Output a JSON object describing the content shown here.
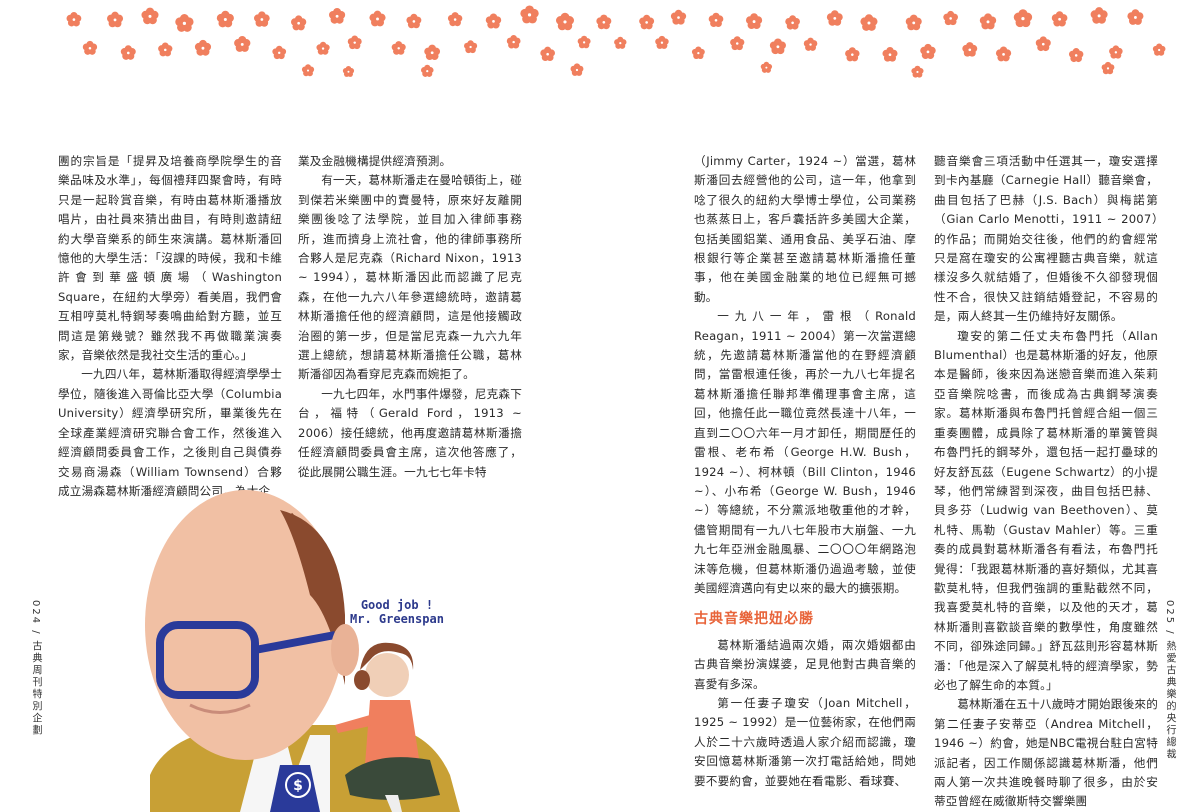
{
  "decoration": {
    "flower_color": "#f07f5e",
    "flower_center": "#ffffff"
  },
  "page_left": {
    "marker": "024 / 古典周刊特別企劃"
  },
  "page_right": {
    "marker": "025 / 熱愛古典樂的央行總裁"
  },
  "illustration": {
    "speech_line1": "Good job !",
    "speech_line2": "Mr. Greenspan",
    "tie_symbol": "$"
  },
  "col1": {
    "p1": "團的宗旨是「提昇及培養商學院學生的音樂品味及水準」，每個禮拜四聚會時，有時只是一起聆賞音樂，有時由葛林斯潘播放唱片，由社員來猜出曲目，有時則邀請紐約大學音樂系的師生來演講。葛林斯潘回憶他的大學生活：「沒課的時候，我和卡維許會到華盛頓廣場（Washington Square，在紐約大學旁）看美眉，我們會互相哼莫札特鋼琴奏鳴曲給對方聽，並互問這是第幾號？雖然我不再做職業演奏家，音樂依然是我社交生活的重心。」",
    "p2": "一九四八年，葛林斯潘取得經濟學學士學位，隨後進入哥倫比亞大學（Columbia University）經濟學研究所，畢業後先在全球產業經濟研究聯合會工作，然後進入經濟顧問委員會工作，之後則自己與債券交易商湯森（William Townsend）合夥成立湯森葛林斯潘經濟顧問公司，為大企"
  },
  "col2": {
    "p1": "業及金融機構提供經濟預測。",
    "p2": "有一天，葛林斯潘走在曼哈頓街上，碰到傑若米樂團中的賣曼特，原來好友離開樂團後唸了法學院，並目加入律師事務所，進而擠身上流社會，他的律師事務所合夥人是尼克森（Richard Nixon，1913 ~ 1994），葛林斯潘因此而認識了尼克森，在他一九六八年參選總統時，邀請葛林斯潘擔任他的經濟顧問，這是他接觸政治圈的第一步，但是當尼克森一九六九年選上總統，想請葛林斯潘擔任公職，葛林斯潘卻因為看穿尼克森而婉拒了。",
    "p3": "一九七四年，水門事件爆發，尼克森下台，福特（Gerald Ford，1913 ~ 2006）接任總統，他再度邀請葛林斯潘擔任經濟顧問委員會主席，這次他答應了，從此展開公職生涯。一九七七年卡特"
  },
  "col3": {
    "p1": "（Jimmy Carter，1924 ~）當選，葛林斯潘回去經營他的公司，這一年，他拿到唸了很久的紐約大學博士學位，公司業務也蒸蒸日上，客戶囊括許多美國大企業，包括美國鋁業、通用食品、美孚石油、摩根銀行等企業甚至邀請葛林斯潘擔任董事，他在美國金融業的地位已經無可撼動。",
    "p2": "一九八一年，雷根（Ronald Reagan，1911 ~ 2004）第一次當選總統，先邀請葛林斯潘當他的在野經濟顧問，當雷根連任後，再於一九八七年提名葛林斯潘擔任聯邦準備理事會主席，這回，他擔任此一職位竟然長達十八年，一直到二〇〇六年一月才卸任，期間歷任的雷根、老布希（George H.W. Bush，1924 ~）、柯林頓（Bill Clinton，1946 ~）、小布希（George W. Bush，1946 ~）等總統，不分黨派地敬重他的才幹，儘管期間有一九八七年股市大崩盤、一九九七年亞洲金融風暴、二〇〇〇年網路泡沫等危機，但葛林斯潘仍過過考驗，並使美國經濟邁向有史以來的最大的擴張期。",
    "subhead": "古典音樂把妞必勝",
    "p3": "葛林斯潘結過兩次婚，兩次婚姻都由古典音樂扮演媒婆，足見他對古典音樂的喜愛有多深。",
    "p4": "第一任妻子瓊安（Joan Mitchell，1925 ~ 1992）是一位藝術家，在他們兩人於二十六歲時透過人家介紹而認識，瓊安回憶葛林斯潘第一次打電話給她，問她要不要約會，並要她在看電影、看球賽、"
  },
  "col4": {
    "p1": "聽音樂會三項活動中任選其一，瓊安選擇到卡內基廳（Carnegie Hall）聽音樂會，曲目包括了巴赫（J.S. Bach）與梅諾第（Gian Carlo Menotti，1911 ~ 2007）的作品；而開始交往後，他們的約會經常只是窩在瓊安的公寓裡聽古典音樂，就這樣沒多久就結婚了，但婚後不久卻發現個性不合，很快又註銷結婚登記，不容易的是，兩人終其一生仍維持好友關係。",
    "p2": "瓊安的第二任丈夫布魯門托（Allan Blumenthal）也是葛林斯潘的好友，他原本是醫師，後來因為迷戀音樂而進入茱莉亞音樂院唸書，而後成為古典鋼琴演奏家。葛林斯潘與布魯門托曾經合組一個三重奏團體，成員除了葛林斯潘的單簧管與布魯門托的鋼琴外，還包括一起打壘球的好友舒瓦茲（Eugene Schwartz）的小提琴，他們常練習到深夜，曲目包括巴赫、貝多芬（Ludwig van Beethoven）、莫札特、馬勒（Gustav Mahler）等。三重奏的成員對葛林斯潘各有看法，布魯門托覺得：「我跟葛林斯潘的喜好類似，尤其喜歡莫札特，但我們強調的重點截然不同，我喜愛莫札特的音樂，以及他的天才，葛林斯潘則喜歡談音樂的數學性，角度雖然不同，卻殊途同歸。」舒瓦茲則形容葛林斯潘：「他是深入了解莫札特的經濟學家，勢必也了解生命的本質。」",
    "p3": "葛林斯潘在五十八歲時才開始跟後來的第二任妻子安蒂亞（Andrea Mitchell，1946 ~）約會，她是NBC電視台駐白宮特派記者，因工作關係認識葛林斯潘，他們兩人第一次共進晚餐時聊了很多，由於安蒂亞曾經在威徹斯特交響樂團"
  }
}
